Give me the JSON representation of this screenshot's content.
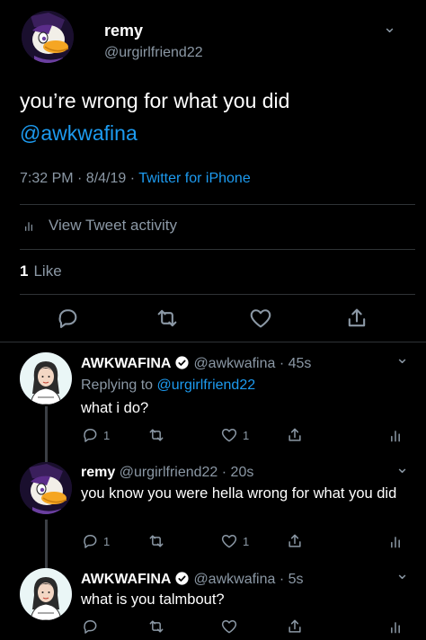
{
  "main_tweet": {
    "name": "remy",
    "handle": "@urgirlfriend22",
    "text_line1": "you’re wrong for what you did",
    "mention": "@awkwafina",
    "time": "7:32 PM · 8/4/19 · ",
    "source": "Twitter for iPhone",
    "activity_label": "View Tweet activity",
    "like_count": "1",
    "like_label": "Like"
  },
  "replies": [
    {
      "name": "AWKWAFINA",
      "handle": "@awkwafina · 45s",
      "replying_prefix": "Replying to ",
      "replying_to": "@urgirlfriend22",
      "text": "what i do?",
      "reply_count": "1",
      "like_count": "1"
    },
    {
      "name": "remy",
      "handle": "@urgirlfriend22 · 20s",
      "text": "you know you were hella wrong for what you did",
      "reply_count": "1",
      "like_count": "1"
    },
    {
      "name": "AWKWAFINA",
      "handle": "@awkwafina · 5s",
      "text": "what is you talmbout?"
    }
  ],
  "icons": {
    "reply": "reply-icon",
    "retweet": "retweet-icon",
    "like": "heart-icon",
    "share": "share-icon",
    "analytics": "analytics-icon",
    "verified": "verified-badge-icon",
    "chevron": "chevron-down-icon"
  },
  "colors": {
    "background": "#000000",
    "link": "#1d9bf0",
    "muted": "#8b98a5",
    "divider": "#2f3336"
  }
}
